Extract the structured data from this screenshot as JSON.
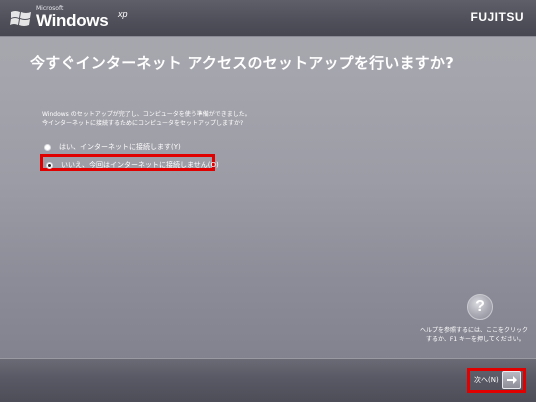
{
  "header": {
    "ms_label": "Microsoft",
    "os_name": "Windows",
    "os_suffix": "xp",
    "brand": "FUJITSU"
  },
  "main": {
    "title": "今すぐインターネット アクセスのセットアップを行いますか?",
    "description_line1": "Windows のセットアップが完了し、コンピュータを使う準備ができました。",
    "description_line2": "今インターネットに接続するためにコンピュータをセットアップしますか?",
    "options": [
      {
        "label": "はい、インターネットに接続します(Y)",
        "selected": false
      },
      {
        "label": "いいえ、今回はインターネットに接続しません(O)",
        "selected": true
      }
    ]
  },
  "help": {
    "icon": "question-mark-icon",
    "line1": "ヘルプを参照するには、ここをクリック",
    "line2": "するか、F1 キーを押してください。"
  },
  "footer": {
    "next_label": "次へ(N)",
    "next_icon": "arrow-right-icon"
  },
  "colors": {
    "highlight": "#e10000"
  }
}
